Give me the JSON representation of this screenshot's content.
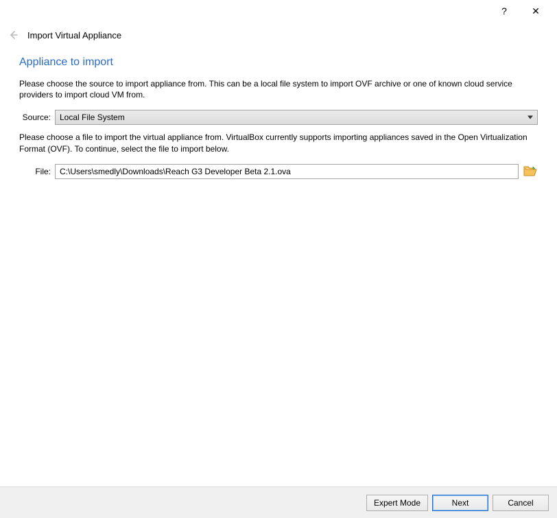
{
  "titlebar": {
    "help": "?",
    "close": "✕"
  },
  "header": {
    "title": "Import Virtual Appliance"
  },
  "page": {
    "heading": "Appliance to import",
    "desc1": "Please choose the source to import appliance from. This can be a local file system to import OVF archive or one of known cloud service providers to import cloud VM from.",
    "source_label": "Source:",
    "source_value": "Local File System",
    "desc2": "Please choose a file to import the virtual appliance from. VirtualBox currently supports importing appliances saved in the Open Virtualization Format (OVF). To continue, select the file to import below.",
    "file_label": "File:",
    "file_value": "C:\\Users\\smedly\\Downloads\\Reach G3 Developer Beta 2.1.ova"
  },
  "footer": {
    "expert": "Expert Mode",
    "next": "Next",
    "cancel": "Cancel"
  }
}
